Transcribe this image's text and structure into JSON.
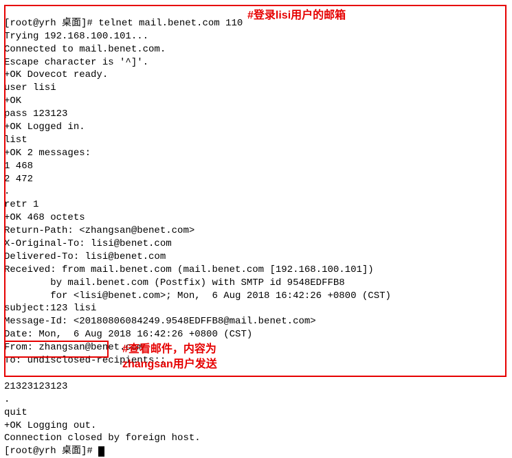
{
  "terminal": {
    "lines": [
      "[root@yrh 桌面]# telnet mail.benet.com 110",
      "Trying 192.168.100.101...",
      "Connected to mail.benet.com.",
      "Escape character is '^]'.",
      "+OK Dovecot ready.",
      "user lisi",
      "+OK",
      "pass 123123",
      "+OK Logged in.",
      "list",
      "+OK 2 messages:",
      "1 468",
      "2 472",
      ".",
      "retr 1",
      "+OK 468 octets",
      "Return-Path: <zhangsan@benet.com>",
      "X-Original-To: lisi@benet.com",
      "Delivered-To: lisi@benet.com",
      "Received: from mail.benet.com (mail.benet.com [192.168.100.101])",
      "        by mail.benet.com (Postfix) with SMTP id 9548EDFFB8",
      "        for <lisi@benet.com>; Mon,  6 Aug 2018 16:42:26 +0800 (CST)",
      "subject:123 lisi",
      "Message-Id: <20180806084249.9548EDFFB8@mail.benet.com>",
      "Date: Mon,  6 Aug 2018 16:42:26 +0800 (CST)",
      "From: zhangsan@benet.com",
      "To: undisclosed-recipients:;",
      "",
      "21323123123",
      ".",
      "quit",
      "+OK Logging out.",
      "Connection closed by foreign host."
    ],
    "final_prompt": "[root@yrh 桌面]# "
  },
  "annotations": {
    "login_note": "#登录lisi用户的邮箱",
    "view_note_line1": "#查看邮件，内容为",
    "view_note_line2": "zhangsan用户发送"
  }
}
